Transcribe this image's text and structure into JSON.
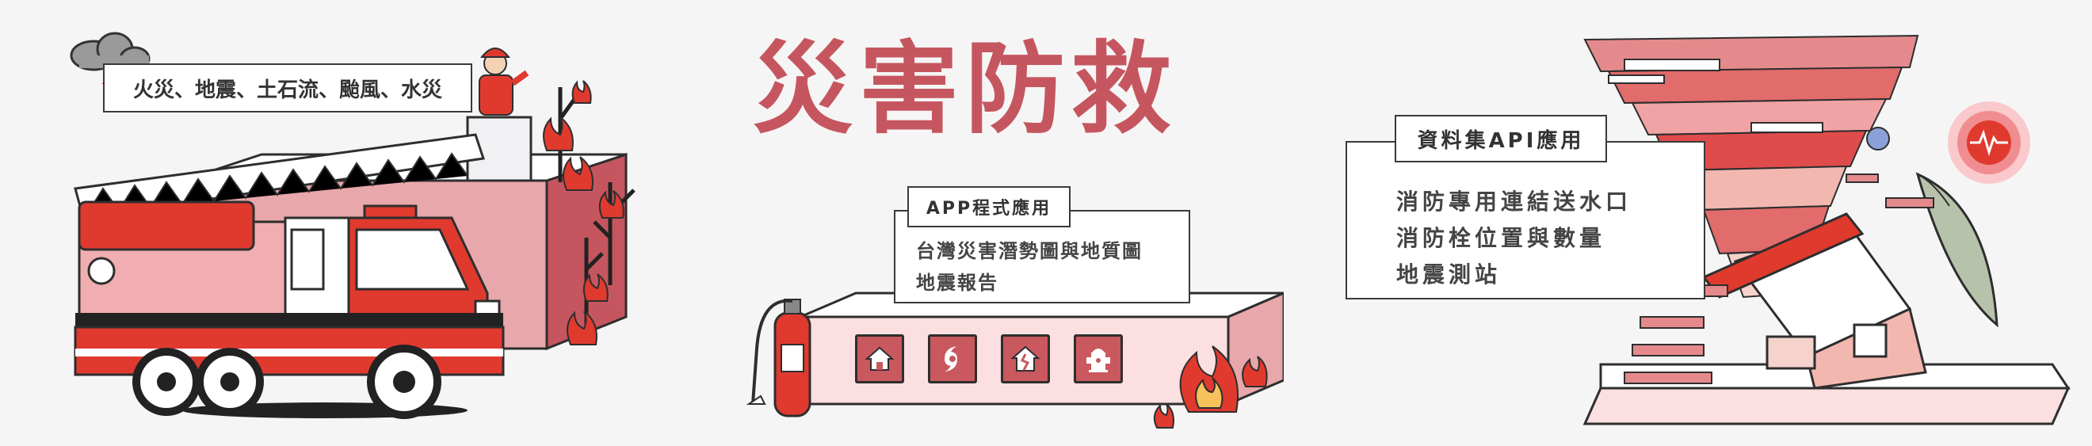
{
  "hazards_tag": "火災、地震、土石流、颱風、水災",
  "main_title": "災害防救",
  "app_section": {
    "tag": "APP程式應用",
    "lines": [
      "台灣災害潛勢圖與地質圖",
      "地震報告"
    ],
    "icons": [
      "house-icon",
      "typhoon-icon",
      "earthquake-house-icon",
      "fire-hydrant-icon"
    ]
  },
  "api_section": {
    "tag": "資料集API應用",
    "lines": [
      "消防專用連結送水口",
      "消防栓位置與數量",
      "地震測站"
    ]
  },
  "colors": {
    "accent": "#c5565f",
    "red": "#e03a2f",
    "pink": "#e8a7aa",
    "outline": "#2e2e2e"
  }
}
